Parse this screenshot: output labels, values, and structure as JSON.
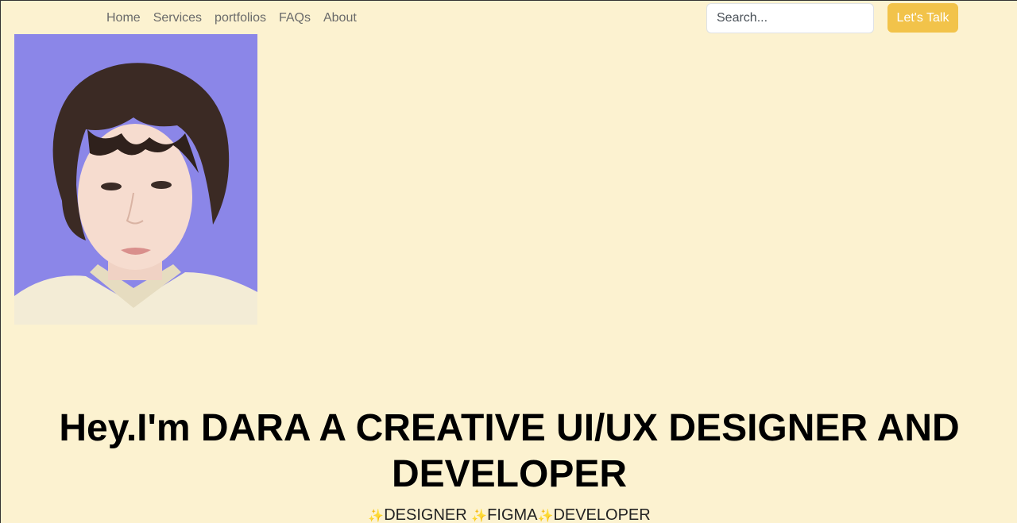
{
  "nav": {
    "links": [
      "Home",
      "Services",
      "portfolios",
      "FAQs",
      "About"
    ],
    "search_placeholder": "Search...",
    "cta_label": "Let's Talk"
  },
  "hero": {
    "title_line1": "Hey.I'm DARA A CREATIVE UI/UX DESIGNER AND",
    "title_line2": "DEVELOPER",
    "roles": [
      "DESIGNER",
      "FIGMA",
      "DEVELOPER"
    ]
  },
  "portrait": {
    "description": "portrait-photo"
  },
  "colors": {
    "background": "#fcf2d0",
    "accent": "#f2c34a",
    "nav_text": "#6a6a6a",
    "portrait_bg": "#8b86e8"
  },
  "icons": {
    "role_separator": "sparkle-icon"
  }
}
